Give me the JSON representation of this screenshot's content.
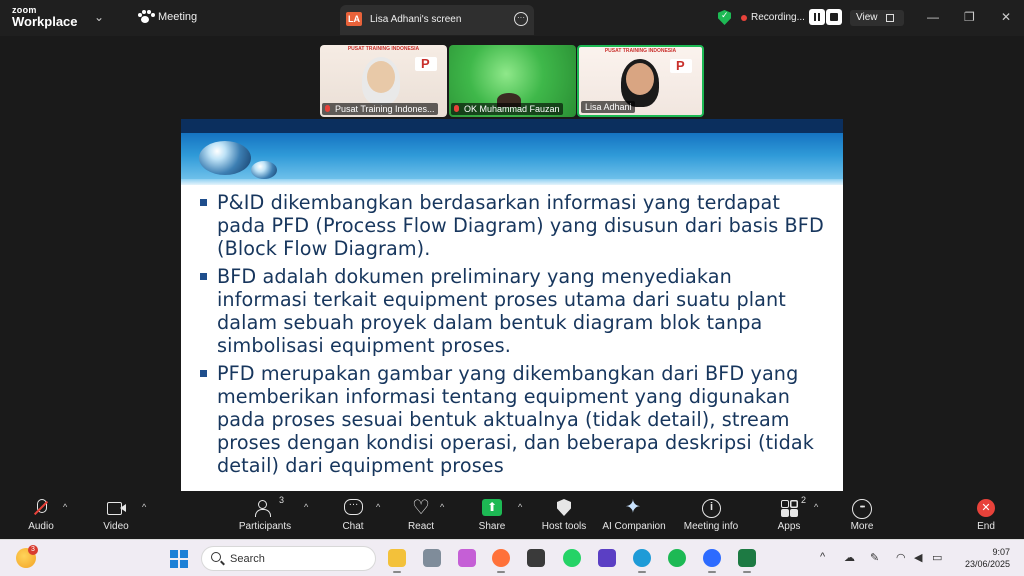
{
  "app": {
    "brand_line1": "zoom",
    "brand_line2": "Workplace",
    "meeting_label": "Meeting",
    "share_tab_initials": "LA",
    "share_tab_title": "Lisa Adhani's screen",
    "recording_label": "Recording...",
    "view_label": "View",
    "colors": {
      "accent_green": "#1db954",
      "record_red": "#e8423a",
      "topbar": "#1f1f1f"
    }
  },
  "participants_strip": [
    {
      "name": "Pusat Training Indones...",
      "brand_text": "PUSAT TRAINING INDONESIA",
      "muted": true
    },
    {
      "name": "OK Muhammad Fauzan",
      "brand_text": "",
      "muted": true
    },
    {
      "name": "Lisa Adhani",
      "brand_text": "PUSAT TRAINING INDONESIA",
      "muted": false,
      "speaking": true
    }
  ],
  "slide": {
    "header_url": "",
    "bullets": [
      "P&ID dikembangkan berdasarkan informasi yang terdapat pada PFD (Process Flow Diagram) yang disusun dari basis BFD (Block Flow Diagram).",
      "BFD adalah dokumen preliminary yang menyediakan informasi terkait equipment proses utama dari suatu plant dalam sebuah proyek dalam bentuk diagram blok tanpa simbolisasi equipment proses.",
      "PFD merupakan gambar yang dikembangkan dari BFD yang memberikan informasi tentang equipment yang digunakan pada proses sesuai bentuk aktualnya (tidak detail), stream proses dengan kondisi operasi, dan beberapa deskripsi (tidak detail) dari equipment proses"
    ]
  },
  "controls": {
    "audio": "Audio",
    "video": "Video",
    "participants": "Participants",
    "participants_count": "3",
    "chat": "Chat",
    "react": "React",
    "share": "Share",
    "host_tools": "Host tools",
    "ai_companion": "AI Companion",
    "meeting_info": "Meeting info",
    "apps": "Apps",
    "apps_count": "2",
    "more": "More",
    "end": "End"
  },
  "taskbar": {
    "weather_badge": "3",
    "search_placeholder": "Search",
    "time": "9:07",
    "date": "23/06/2025"
  }
}
